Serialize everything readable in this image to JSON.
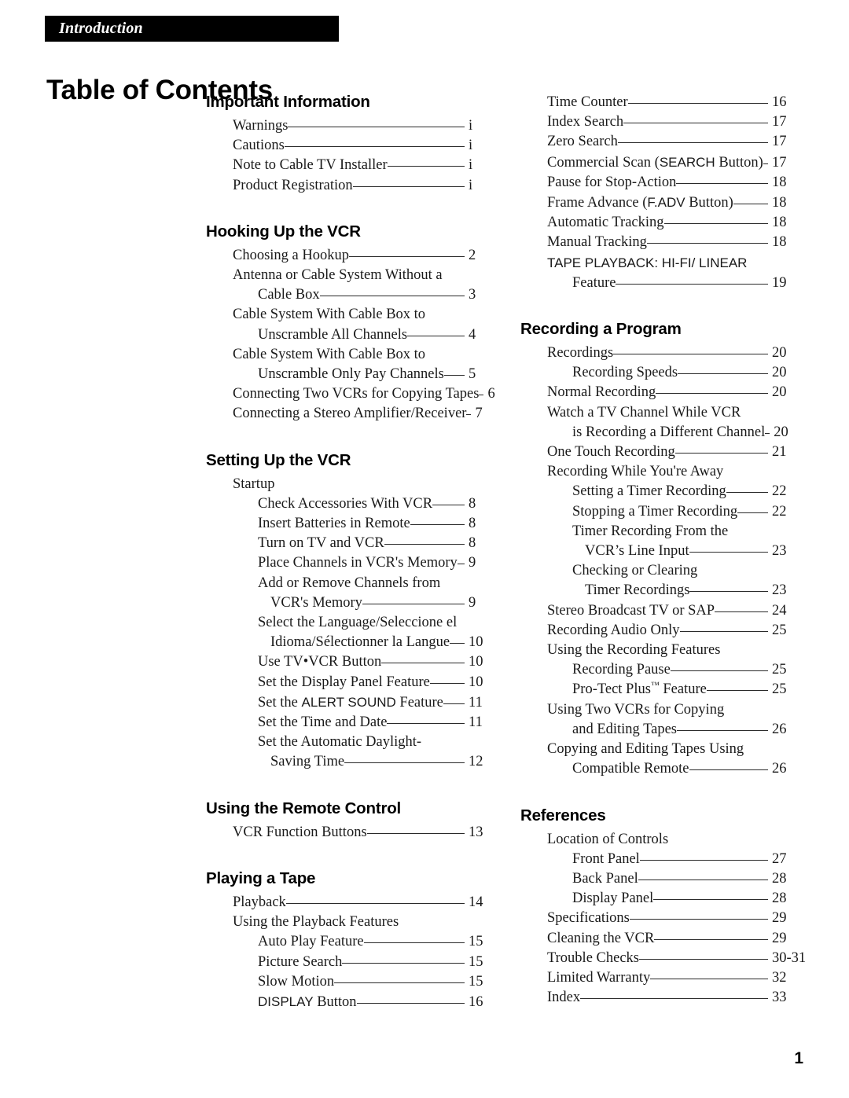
{
  "banner": {
    "running_head": "Introduction"
  },
  "page_title": "Table of Contents",
  "folio": "1",
  "left_column": {
    "sections": [
      {
        "heading": "Important Information",
        "entries": [
          {
            "label": "Warnings",
            "page": "i",
            "level": 1
          },
          {
            "label": "Cautions",
            "page": "i",
            "level": 1
          },
          {
            "label": "Note to Cable TV Installer",
            "page": "i",
            "level": 1
          },
          {
            "label": "Product Registration",
            "page": "i",
            "level": 1
          }
        ]
      },
      {
        "heading": "Hooking Up the VCR",
        "entries": [
          {
            "label": "Choosing a Hookup",
            "page": "2",
            "level": 1
          },
          {
            "label": "Antenna or Cable System Without a",
            "page": "",
            "level": 1
          },
          {
            "label": "Cable Box",
            "page": "3",
            "level": 2
          },
          {
            "label": "Cable System With Cable Box to",
            "page": "",
            "level": 1
          },
          {
            "label": "Unscramble All Channels",
            "page": "4",
            "level": 2
          },
          {
            "label": "Cable System With Cable Box to",
            "page": "",
            "level": 1
          },
          {
            "label": "Unscramble Only Pay Channels",
            "page": "5",
            "level": 2
          },
          {
            "label": "Connecting Two VCRs for Copying Tapes",
            "page": "6",
            "level": 1
          },
          {
            "label": "Connecting a Stereo Amplifier/Receiver",
            "page": "7",
            "level": 1
          }
        ]
      },
      {
        "heading": "Setting Up the VCR",
        "entries": [
          {
            "label": "Startup",
            "page": "",
            "level": 1
          },
          {
            "label": "Check Accessories With VCR",
            "page": "8",
            "level": 2
          },
          {
            "label": "Insert Batteries in Remote",
            "page": "8",
            "level": 2
          },
          {
            "label": "Turn on TV and VCR",
            "page": "8",
            "level": 2
          },
          {
            "label": "Place Channels in VCR's Memory",
            "page": "9",
            "level": 2
          },
          {
            "label": "Add or Remove Channels from",
            "page": "",
            "level": 2
          },
          {
            "label": "VCR's Memory",
            "page": "9",
            "level": 3
          },
          {
            "label": "Select the Language/Seleccione el",
            "page": "",
            "level": 2
          },
          {
            "label": "Idioma/Sélectionner la Langue",
            "page": "10",
            "level": 3
          },
          {
            "label": "Use TV•VCR Button",
            "page": "10",
            "level": 2
          },
          {
            "label": "Set the Display Panel Feature",
            "page": "10",
            "level": 2
          },
          {
            "label": "Set the ALERT SOUND Feature",
            "page": "11",
            "level": 2,
            "sans_part": "ALERT SOUND",
            "prefix": "Set the ",
            "suffix": " Feature"
          },
          {
            "label": "Set the Time and Date",
            "page": "11",
            "level": 2
          },
          {
            "label": "Set the Automatic Daylight-",
            "page": "",
            "level": 2
          },
          {
            "label": "Saving Time",
            "page": "12",
            "level": 3
          }
        ]
      },
      {
        "heading": "Using the Remote Control",
        "entries": [
          {
            "label": "VCR Function Buttons",
            "page": "13",
            "level": 1
          }
        ]
      },
      {
        "heading": "Playing a Tape",
        "entries": [
          {
            "label": "Playback",
            "page": "14",
            "level": 1
          },
          {
            "label": "Using the Playback Features",
            "page": "",
            "level": 1
          },
          {
            "label": "Auto Play Feature",
            "page": "15",
            "level": 2
          },
          {
            "label": "Picture Search",
            "page": "15",
            "level": 2
          },
          {
            "label": "Slow Motion",
            "page": "15",
            "level": 2
          },
          {
            "label": "DISPLAY Button",
            "page": "16",
            "level": 2,
            "sans_part": "DISPLAY",
            "prefix": "",
            "suffix": " Button"
          }
        ]
      }
    ]
  },
  "right_column": {
    "sections": [
      {
        "heading": "",
        "entries": [
          {
            "label": "Time Counter",
            "page": "16",
            "level": 1
          },
          {
            "label": "Index Search",
            "page": "17",
            "level": 1
          },
          {
            "label": "Zero Search",
            "page": "17",
            "level": 1
          },
          {
            "label": "Commercial Scan (SEARCH Button)",
            "page": "17",
            "level": 1,
            "sans_part": "SEARCH",
            "prefix": "Commercial Scan (",
            "suffix": " Button)"
          },
          {
            "label": "Pause for Stop-Action",
            "page": "18",
            "level": 1
          },
          {
            "label": "Frame Advance (F.ADV Button)",
            "page": "18",
            "level": 1,
            "sans_part": "F.ADV",
            "prefix": "Frame Advance (",
            "suffix": " Button)"
          },
          {
            "label": "Automatic Tracking",
            "page": "18",
            "level": 1
          },
          {
            "label": "Manual Tracking",
            "page": "18",
            "level": 1
          },
          {
            "label": "TAPE PLAYBACK: HI-FI/ LINEAR",
            "page": "",
            "level": 1,
            "all_sans": true
          },
          {
            "label": "Feature",
            "page": "19",
            "level": 2
          }
        ]
      },
      {
        "heading": "Recording a Program",
        "entries": [
          {
            "label": "Recordings",
            "page": "20",
            "level": 1
          },
          {
            "label": "Recording Speeds",
            "page": "20",
            "level": 2
          },
          {
            "label": "Normal Recording",
            "page": "20",
            "level": 1
          },
          {
            "label": "Watch a TV Channel While VCR",
            "page": "",
            "level": 1
          },
          {
            "label": "is Recording a Different Channel",
            "page": "20",
            "level": 2
          },
          {
            "label": "One Touch Recording",
            "page": "21",
            "level": 1
          },
          {
            "label": "Recording While You're Away",
            "page": "",
            "level": 1
          },
          {
            "label": "Setting a Timer Recording",
            "page": "22",
            "level": 2
          },
          {
            "label": "Stopping a Timer Recording",
            "page": "22",
            "level": 2
          },
          {
            "label": "Timer Recording From the",
            "page": "",
            "level": 2
          },
          {
            "label": "VCR’s Line Input",
            "page": "23",
            "level": 3
          },
          {
            "label": "Checking or Clearing",
            "page": "",
            "level": 2
          },
          {
            "label": "Timer Recordings",
            "page": "23",
            "level": 3
          },
          {
            "label": "Stereo Broadcast TV or SAP",
            "page": "24",
            "level": 1
          },
          {
            "label": "Recording Audio Only",
            "page": "25",
            "level": 1
          },
          {
            "label": "Using the Recording Features",
            "page": "",
            "level": 1
          },
          {
            "label": "Recording Pause",
            "page": "25",
            "level": 2
          },
          {
            "label": "Pro-Tect Plus™ Feature",
            "page": "25",
            "level": 2,
            "trademark": true,
            "prefix": "Pro-Tect Plus",
            "suffix": " Feature"
          },
          {
            "label": "Using Two VCRs for Copying",
            "page": "",
            "level": 1
          },
          {
            "label": "and Editing Tapes",
            "page": "26",
            "level": 2
          },
          {
            "label": "Copying and Editing Tapes Using",
            "page": "",
            "level": 1
          },
          {
            "label": "Compatible Remote",
            "page": "26",
            "level": 2
          }
        ]
      },
      {
        "heading": "References",
        "entries": [
          {
            "label": "Location of Controls",
            "page": "",
            "level": 1
          },
          {
            "label": "Front Panel",
            "page": "27",
            "level": 2
          },
          {
            "label": "Back Panel",
            "page": "28",
            "level": 2
          },
          {
            "label": "Display Panel",
            "page": "28",
            "level": 2
          },
          {
            "label": "Specifications",
            "page": "29",
            "level": 1
          },
          {
            "label": "Cleaning the VCR",
            "page": "29",
            "level": 1
          },
          {
            "label": "Trouble Checks",
            "page": "30-31",
            "level": 1
          },
          {
            "label": "Limited Warranty",
            "page": "32",
            "level": 1
          },
          {
            "label": "Index",
            "page": "33",
            "level": 1
          }
        ]
      }
    ]
  }
}
